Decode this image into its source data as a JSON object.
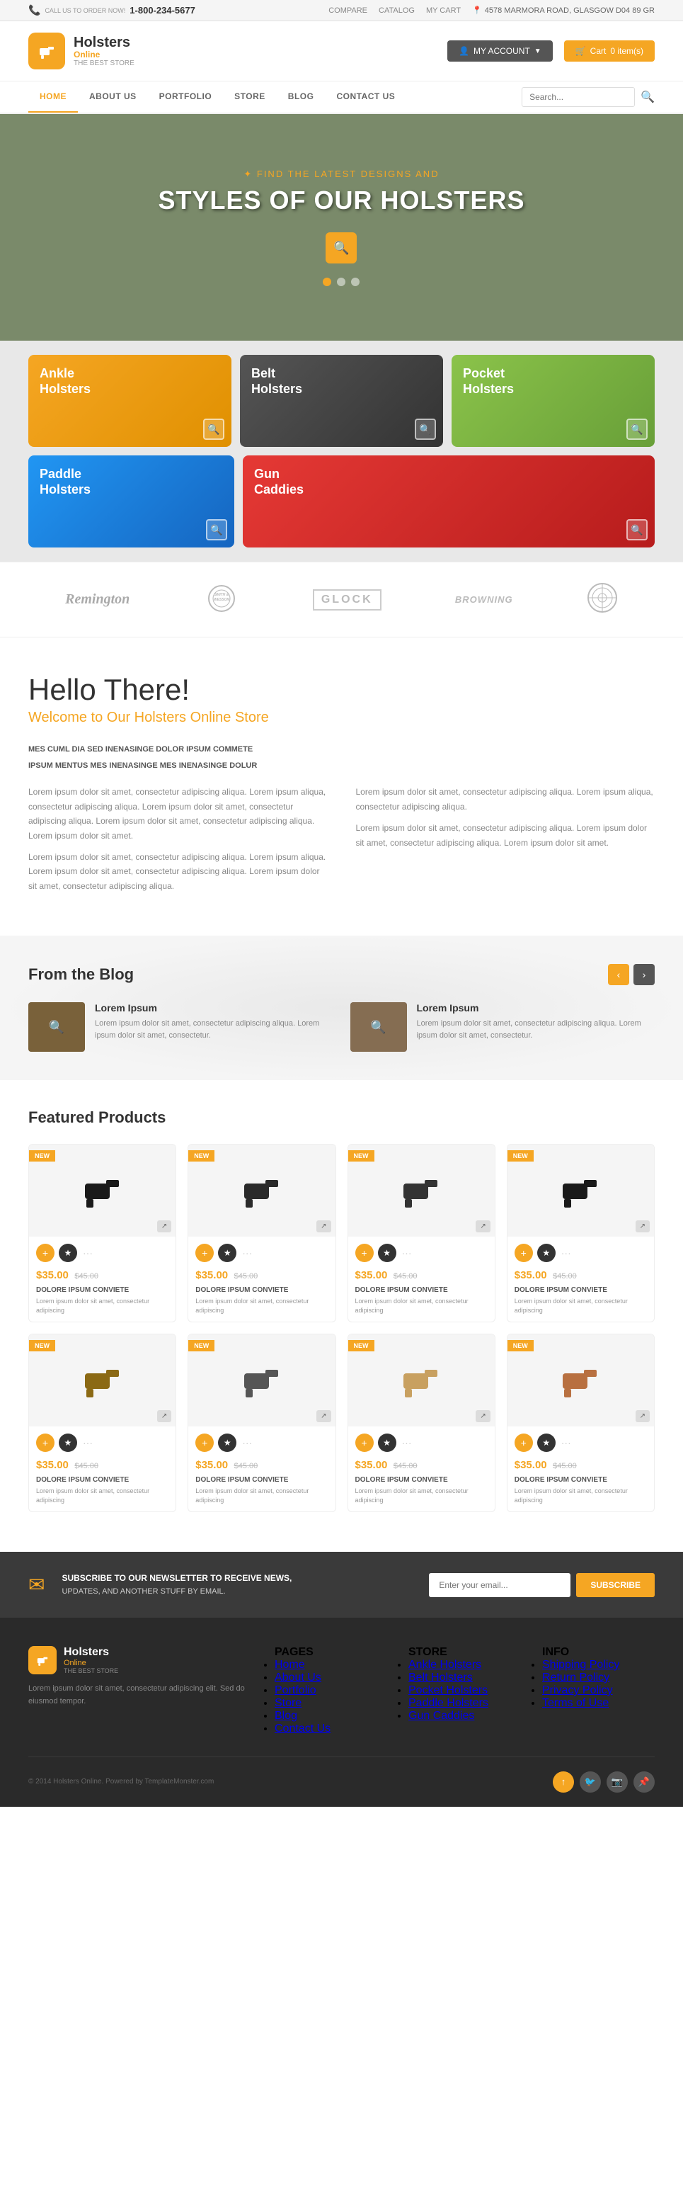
{
  "topbar": {
    "phone_label": "CALL US TO ORDER NOW!",
    "phone": "1-800-234-5677",
    "links": [
      "COMPARE",
      "CATALOG",
      "MY CART"
    ],
    "address_icon": "📍",
    "address": "4578 MARMORA ROAD, GLASGOW D04 89 GR"
  },
  "header": {
    "logo_icon": "🔫",
    "brand": "Holsters",
    "sub": "Online",
    "tagline": "THE BEST STORE",
    "account_label": "MY ACCOUNT",
    "cart_label": "Cart",
    "cart_count": "0 item(s)"
  },
  "nav": {
    "links": [
      "HOME",
      "ABOUT US",
      "PORTFOLIO",
      "STORE",
      "BLOG",
      "CONTACT US"
    ],
    "active": "HOME",
    "search_placeholder": "Search..."
  },
  "hero": {
    "subtitle": "✦ FIND THE LATEST DESIGNS AND",
    "title": "STYLES OF OUR HOLSTERS",
    "dots": 3
  },
  "categories": {
    "items": [
      {
        "label": "Ankle Holsters",
        "class": "cat-ankle"
      },
      {
        "label": "Belt Holsters",
        "class": "cat-belt"
      },
      {
        "label": "Pocket Holsters",
        "class": "cat-pocket"
      },
      {
        "label": "Paddle Holsters",
        "class": "cat-paddle"
      },
      {
        "label": "Gun Caddies",
        "class": "cat-gun"
      }
    ]
  },
  "brands": [
    {
      "name": "Remington",
      "class": "remington"
    },
    {
      "name": "Smith & Wesson",
      "class": "smith"
    },
    {
      "name": "GLOCK",
      "class": "glock"
    },
    {
      "name": "BROWNING",
      "class": "browning"
    },
    {
      "name": "⚙",
      "class": "icon-brand"
    }
  ],
  "about": {
    "heading": "Hello There!",
    "subheading": "Welcome to Our Holsters Online Store",
    "heading_label": "MES CUML DIA SED INENASINGE DOLOR IPSUM COMMETE",
    "subheading2": "IPSUM MENTUS MES INENASINGE MES INENASINGE DOLUR",
    "paragraphs": [
      "Lorem ipsum dolor sit amet, consectetur adipiscing aliqua. Lorem ipsum aliqua, consectetur adipiscing aliqua. Lorem ipsum dolor sit amet, consectetur adipiscing aliqua. Lorem ipsum dolor sit amet, consectetur adipiscing aliqua. Lorem ipsum dolor sit amet.",
      "Lorem ipsum dolor sit amet, consectetur adipiscing aliqua. Lorem ipsum aliqua. Lorem ipsum dolor sit amet, consectetur adipiscing aliqua. Lorem ipsum dolor sit amet, consectetur adipiscing aliqua.",
      "Lorem ipsum dolor sit amet, consectetur adipiscing aliqua. Lorem ipsum aliqua, consectetur adipiscing aliqua.",
      "Lorem ipsum dolor sit amet, consectetur adipiscing aliqua. Lorem ipsum dolor sit amet, consectetur adipiscing aliqua. Lorem ipsum dolor sit amet."
    ]
  },
  "blog": {
    "heading": "From the Blog",
    "posts": [
      {
        "title": "Lorem Ipsum",
        "desc": "Lorem ipsum dolor sit amet, consectetur adipiscing aliqua. Lorem ipsum dolor sit amet, consectetur."
      },
      {
        "title": "Lorem Ipsum",
        "desc": "Lorem ipsum dolor sit amet, consectetur adipiscing aliqua. Lorem ipsum dolor sit amet, consectetur."
      }
    ]
  },
  "featured": {
    "heading": "Featured Products",
    "products": [
      {
        "price": "$35.00",
        "old_price": "$45.00",
        "name": "DOLORE IPSUM CONVIETE",
        "desc": "Lorem ipsum dolor sit amet, consectetur adipiscing",
        "badge": "NEW"
      },
      {
        "price": "$35.00",
        "old_price": "$45.00",
        "name": "DOLORE IPSUM CONVIETE",
        "desc": "Lorem ipsum dolor sit amet, consectetur adipiscing",
        "badge": "NEW"
      },
      {
        "price": "$35.00",
        "old_price": "$45.00",
        "name": "DOLORE IPSUM CONVIETE",
        "desc": "Lorem ipsum dolor sit amet, consectetur adipiscing",
        "badge": "NEW"
      },
      {
        "price": "$35.00",
        "old_price": "$45.00",
        "name": "DOLORE IPSUM CONVIETE",
        "desc": "Lorem ipsum dolor sit amet, consectetur adipiscing",
        "badge": "NEW"
      },
      {
        "price": "$35.00",
        "old_price": "$45.00",
        "name": "DOLORE IPSUM CONVIETE",
        "desc": "Lorem ipsum dolor sit amet, consectetur adipiscing",
        "badge": "NEW"
      },
      {
        "price": "$35.00",
        "old_price": "$45.00",
        "name": "DOLORE IPSUM CONVIETE",
        "desc": "Lorem ipsum dolor sit amet, consectetur adipiscing",
        "badge": "NEW"
      },
      {
        "price": "$35.00",
        "old_price": "$45.00",
        "name": "DOLORE IPSUM CONVIETE",
        "desc": "Lorem ipsum dolor sit amet, consectetur adipiscing",
        "badge": "NEW"
      },
      {
        "price": "$35.00",
        "old_price": "$45.00",
        "name": "DOLORE IPSUM CONVIETE",
        "desc": "Lorem ipsum dolor sit amet, consectetur adipiscing",
        "badge": "NEW"
      }
    ]
  },
  "newsletter": {
    "heading": "SUBSCRIBE TO OUR NEWSLETTER TO RECEIVE NEWS,",
    "subheading": "UPDATES, AND ANOTHER STUFF BY EMAIL.",
    "placeholder": "Enter your email...",
    "button": "Subscribe"
  },
  "footer": {
    "brand": "Holsters",
    "sub": "Online",
    "tagline": "THE BEST STORE",
    "desc": "Lorem ipsum dolor sit amet, consectetur adipiscing elit. Sed do eiusmod tempor.",
    "cols": [
      {
        "heading": "PAGES",
        "links": [
          "Home",
          "About Us",
          "Portfolio",
          "Store",
          "Blog",
          "Contact Us"
        ]
      },
      {
        "heading": "STORE",
        "links": [
          "Ankle Holsters",
          "Belt Holsters",
          "Pocket Holsters",
          "Paddle Holsters",
          "Gun Caddies"
        ]
      },
      {
        "heading": "INFO",
        "links": [
          "Shipping Policy",
          "Return Policy",
          "Privacy Policy",
          "Terms of Use"
        ]
      }
    ],
    "copy": "© 2014 Holsters Online. Powered by TemplateMonster.com",
    "social": [
      "↑",
      "🐦",
      "📷",
      "📌"
    ]
  }
}
